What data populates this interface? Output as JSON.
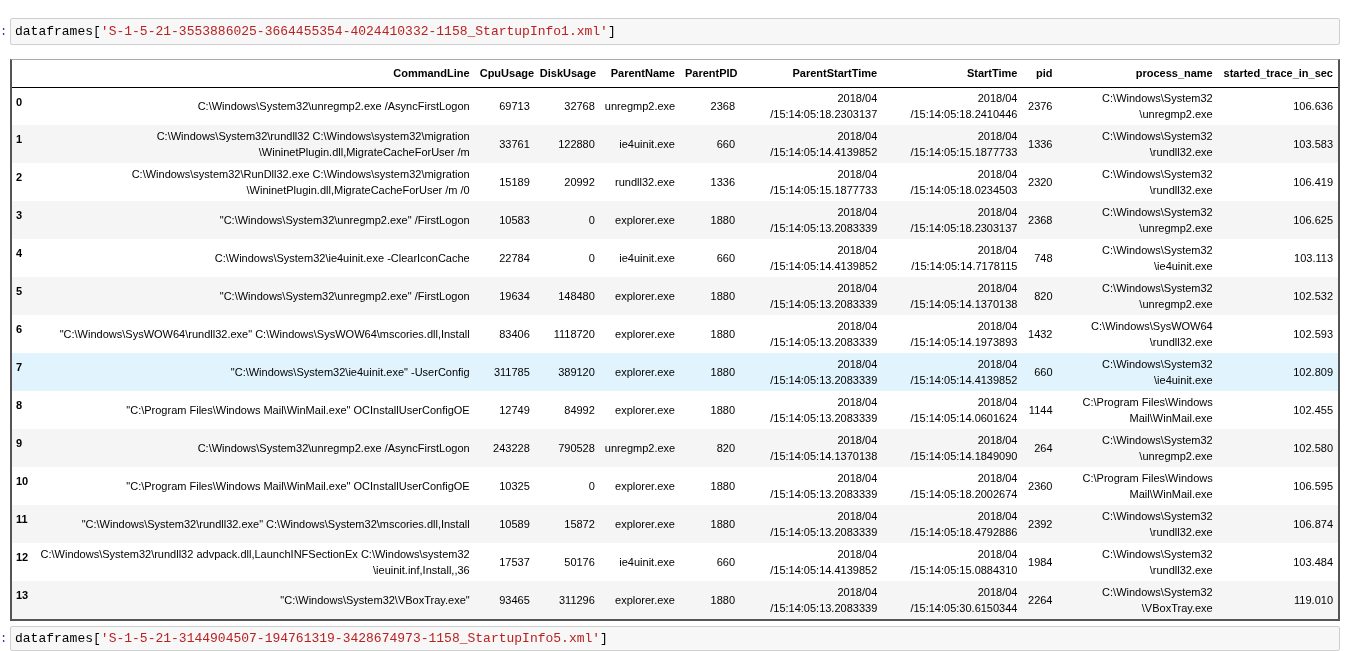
{
  "cells": [
    {
      "prompt": ":",
      "code": "dataframes[",
      "string": "'S-1-5-21-3553886025-3664455354-4024410332-1158_StartupInfo1.xml'",
      "close": "]"
    }
  ],
  "table": {
    "columns": [
      "",
      "CommandLine",
      "CpuUsage",
      "DiskUsage",
      "ParentName",
      "ParentPID",
      "ParentStartTime",
      "StartTime",
      "pid",
      "process_name",
      "started_trace_in_sec"
    ],
    "rows": [
      {
        "highlighted": false,
        "cells": [
          "0",
          "C:\\Windows\\System32\\unregmp2.exe /AsyncFirstLogon",
          "69713",
          "32768",
          "unregmp2.exe",
          "2368",
          "2018/04\n/15:14:05:18.2303137",
          "2018/04\n/15:14:05:18.2410446",
          "2376",
          "C:\\Windows\\System32\n\\unregmp2.exe",
          "106.636"
        ]
      },
      {
        "highlighted": false,
        "cells": [
          "1",
          "C:\\Windows\\System32\\rundll32 C:\\Windows\\system32\\migration\n\\WininetPlugin.dll,MigrateCacheForUser /m",
          "33761",
          "122880",
          "ie4uinit.exe",
          "660",
          "2018/04\n/15:14:05:14.4139852",
          "2018/04\n/15:14:05:15.1877733",
          "1336",
          "C:\\Windows\\System32\n\\rundll32.exe",
          "103.583"
        ]
      },
      {
        "highlighted": false,
        "cells": [
          "2",
          "C:\\Windows\\system32\\RunDll32.exe C:\\Windows\\system32\\migration\n\\WininetPlugin.dll,MigrateCacheForUser /m /0",
          "15189",
          "20992",
          "rundll32.exe",
          "1336",
          "2018/04\n/15:14:05:15.1877733",
          "2018/04\n/15:14:05:18.0234503",
          "2320",
          "C:\\Windows\\System32\n\\rundll32.exe",
          "106.419"
        ]
      },
      {
        "highlighted": false,
        "cells": [
          "3",
          "\"C:\\Windows\\System32\\unregmp2.exe\" /FirstLogon",
          "10583",
          "0",
          "explorer.exe",
          "1880",
          "2018/04\n/15:14:05:13.2083339",
          "2018/04\n/15:14:05:18.2303137",
          "2368",
          "C:\\Windows\\System32\n\\unregmp2.exe",
          "106.625"
        ]
      },
      {
        "highlighted": false,
        "cells": [
          "4",
          "C:\\Windows\\System32\\ie4uinit.exe -ClearIconCache",
          "22784",
          "0",
          "ie4uinit.exe",
          "660",
          "2018/04\n/15:14:05:14.4139852",
          "2018/04\n/15:14:05:14.7178115",
          "748",
          "C:\\Windows\\System32\n\\ie4uinit.exe",
          "103.113"
        ]
      },
      {
        "highlighted": false,
        "cells": [
          "5",
          "\"C:\\Windows\\System32\\unregmp2.exe\" /FirstLogon",
          "19634",
          "148480",
          "explorer.exe",
          "1880",
          "2018/04\n/15:14:05:13.2083339",
          "2018/04\n/15:14:05:14.1370138",
          "820",
          "C:\\Windows\\System32\n\\unregmp2.exe",
          "102.532"
        ]
      },
      {
        "highlighted": false,
        "cells": [
          "6",
          "\"C:\\Windows\\SysWOW64\\rundll32.exe\" C:\\Windows\\SysWOW64\\mscories.dll,Install",
          "83406",
          "1118720",
          "explorer.exe",
          "1880",
          "2018/04\n/15:14:05:13.2083339",
          "2018/04\n/15:14:05:14.1973893",
          "1432",
          "C:\\Windows\\SysWOW64\n\\rundll32.exe",
          "102.593"
        ]
      },
      {
        "highlighted": true,
        "cells": [
          "7",
          "\"C:\\Windows\\System32\\ie4uinit.exe\" -UserConfig",
          "311785",
          "389120",
          "explorer.exe",
          "1880",
          "2018/04\n/15:14:05:13.2083339",
          "2018/04\n/15:14:05:14.4139852",
          "660",
          "C:\\Windows\\System32\n\\ie4uinit.exe",
          "102.809"
        ]
      },
      {
        "highlighted": false,
        "cells": [
          "8",
          "\"C:\\Program Files\\Windows Mail\\WinMail.exe\" OCInstallUserConfigOE",
          "12749",
          "84992",
          "explorer.exe",
          "1880",
          "2018/04\n/15:14:05:13.2083339",
          "2018/04\n/15:14:05:14.0601624",
          "1144",
          "C:\\Program Files\\Windows\nMail\\WinMail.exe",
          "102.455"
        ]
      },
      {
        "highlighted": false,
        "cells": [
          "9",
          "C:\\Windows\\System32\\unregmp2.exe /AsyncFirstLogon",
          "243228",
          "790528",
          "unregmp2.exe",
          "820",
          "2018/04\n/15:14:05:14.1370138",
          "2018/04\n/15:14:05:14.1849090",
          "264",
          "C:\\Windows\\System32\n\\unregmp2.exe",
          "102.580"
        ]
      },
      {
        "highlighted": false,
        "cells": [
          "10",
          "\"C:\\Program Files\\Windows Mail\\WinMail.exe\" OCInstallUserConfigOE",
          "10325",
          "0",
          "explorer.exe",
          "1880",
          "2018/04\n/15:14:05:13.2083339",
          "2018/04\n/15:14:05:18.2002674",
          "2360",
          "C:\\Program Files\\Windows\nMail\\WinMail.exe",
          "106.595"
        ]
      },
      {
        "highlighted": false,
        "cells": [
          "11",
          "\"C:\\Windows\\System32\\rundll32.exe\" C:\\Windows\\System32\\mscories.dll,Install",
          "10589",
          "15872",
          "explorer.exe",
          "1880",
          "2018/04\n/15:14:05:13.2083339",
          "2018/04\n/15:14:05:18.4792886",
          "2392",
          "C:\\Windows\\System32\n\\rundll32.exe",
          "106.874"
        ]
      },
      {
        "highlighted": false,
        "cells": [
          "12",
          "C:\\Windows\\System32\\rundll32 advpack.dll,LaunchINFSectionEx C:\\Windows\\system32\n\\ieuinit.inf,Install,,36",
          "17537",
          "50176",
          "ie4uinit.exe",
          "660",
          "2018/04\n/15:14:05:14.4139852",
          "2018/04\n/15:14:05:15.0884310",
          "1984",
          "C:\\Windows\\System32\n\\rundll32.exe",
          "103.484"
        ]
      },
      {
        "highlighted": false,
        "cells": [
          "13",
          "\"C:\\Windows\\System32\\VBoxTray.exe\"",
          "93465",
          "311296",
          "explorer.exe",
          "1880",
          "2018/04\n/15:14:05:13.2083339",
          "2018/04\n/15:14:05:30.6150344",
          "2264",
          "C:\\Windows\\System32\n\\VBoxTray.exe",
          "119.010"
        ]
      }
    ]
  },
  "next_cell": {
    "prompt": ":",
    "code": "dataframes[",
    "string": "'S-1-5-21-3144904507-194761319-3428674973-1158_StartupInfo5.xml'",
    "close": "]"
  }
}
